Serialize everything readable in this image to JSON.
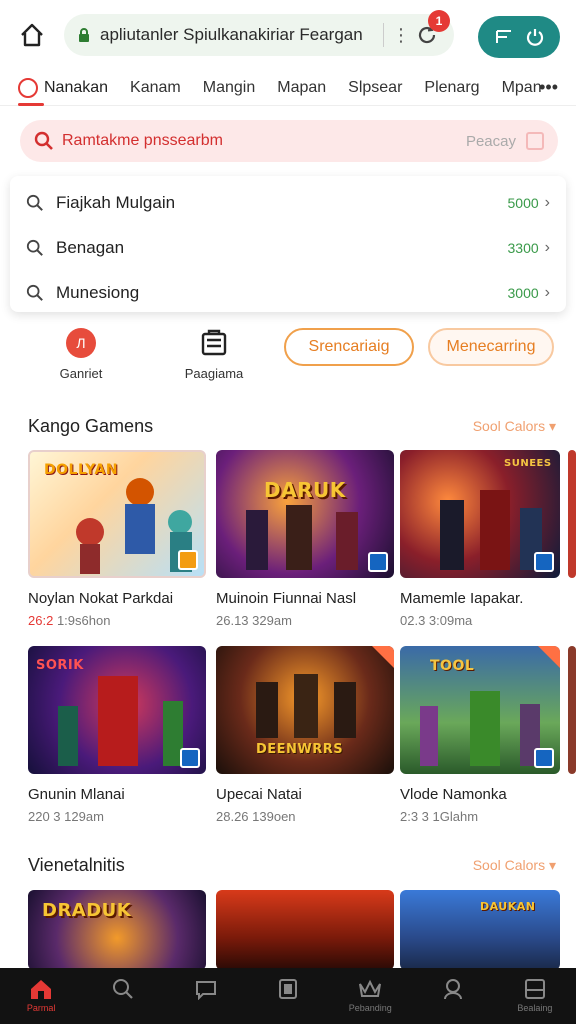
{
  "browser": {
    "url": "apliutanler Spiulkanakiriar Feargan",
    "notifications": "1"
  },
  "tabs": [
    "Nanakan",
    "Kanam",
    "Mangin",
    "Mapan",
    "Slpsear",
    "Plenarg",
    "Mpan"
  ],
  "search": {
    "placeholder": "Ramtakme pnssearbm",
    "right_label": "Peacay"
  },
  "suggestions": [
    {
      "label": "Fiajkah Mulgain",
      "value": "5000"
    },
    {
      "label": "Benagan",
      "value": "3300"
    },
    {
      "label": "Munesiong",
      "value": "3000"
    }
  ],
  "actions": {
    "game": "Ganriet",
    "page": "Paagiama",
    "pill_primary": "Srencariaig",
    "pill_secondary": "Menecarring"
  },
  "sections": [
    {
      "title": "Kango Gamens",
      "link": "Sool Calors",
      "cards": [
        {
          "title": "Noylan Nokat Parkdai",
          "meta_hl": "26:2",
          "meta": "1:9s6hon",
          "logo": "DOLLYAN"
        },
        {
          "title": "Muinoin Fiunnai Nasl",
          "meta": "26.13 329am",
          "logo": "DARUK"
        },
        {
          "title": "Mamemle Iapakar.",
          "meta": "02.3 3:09ma",
          "logo": "SUNEES"
        },
        {
          "title": "Gnunin Mlanai",
          "meta": "220 3 129am",
          "logo": "SORIK"
        },
        {
          "title": "Upecai Natai",
          "meta": "28.26 139oen",
          "logo": "DEENWRRS"
        },
        {
          "title": "Vlode Namonka",
          "meta": "2:3 3 1Glahm",
          "logo": "TOOL"
        }
      ]
    },
    {
      "title": "Vienetalnitis",
      "link": "Sool Calors",
      "cards": [
        {
          "title": "",
          "meta": "",
          "logo": "DRADUK"
        },
        {
          "title": "",
          "meta": "",
          "logo": ""
        },
        {
          "title": "",
          "meta": "",
          "logo": "DAUKAN"
        }
      ]
    }
  ],
  "bottom_nav": [
    {
      "icon": "home-icon",
      "label": "Parmal"
    },
    {
      "icon": "search-icon",
      "label": ""
    },
    {
      "icon": "chat-icon",
      "label": ""
    },
    {
      "icon": "book-icon",
      "label": ""
    },
    {
      "icon": "crown-icon",
      "label": "Pebanding"
    },
    {
      "icon": "profile-icon",
      "label": ""
    },
    {
      "icon": "menu-icon",
      "label": "Bealaing"
    }
  ],
  "colors": {
    "accent": "#e53935",
    "teal": "#1f8a85",
    "orange": "#f0a04b"
  }
}
